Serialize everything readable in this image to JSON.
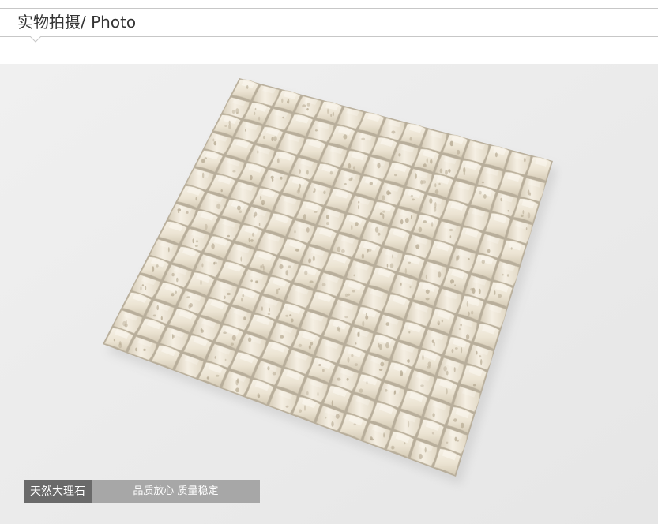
{
  "header": {
    "title": "实物拍摄/ Photo"
  },
  "photo": {
    "subject": "mosaic-tile-sheet",
    "colors": {
      "background": "#ececec",
      "tile_light": "#f2ece0",
      "tile_mid": "#e4dccb",
      "tile_shadow": "#cfc5b1",
      "tile_hole": "#b9ad96"
    }
  },
  "caption": {
    "tag": "天然大理石",
    "note": "品质放心 质量稳定",
    "colors": {
      "tag_bg": "#6a6a6a",
      "note_bg": "#9b9b9b"
    }
  }
}
